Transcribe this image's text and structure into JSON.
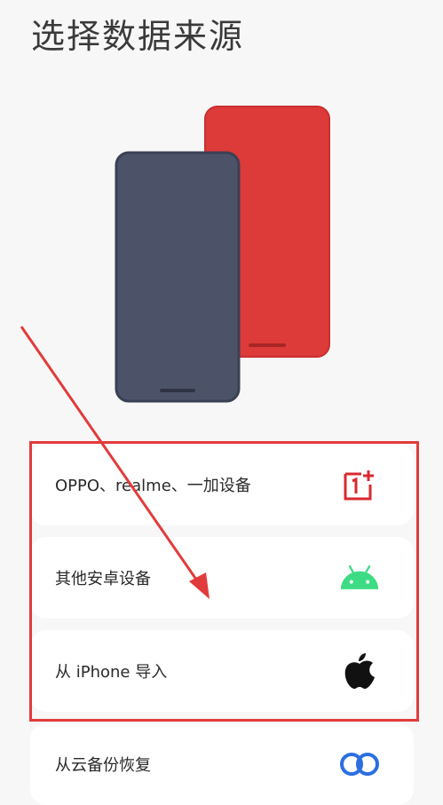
{
  "page": {
    "title": "选择数据来源"
  },
  "options": [
    {
      "label": "OPPO、realme、一加设备",
      "icon": "oneplus-logo-icon"
    },
    {
      "label": "其他安卓设备",
      "icon": "android-icon"
    },
    {
      "label": "从 iPhone 导入",
      "icon": "apple-icon"
    },
    {
      "label": "从云备份恢复",
      "icon": "cloud-backup-icon"
    }
  ],
  "colors": {
    "accent_red": "#e23b3b",
    "phone_dark": "#4c5369",
    "phone_red": "#dd3a3a",
    "android_green": "#3ddc84"
  },
  "annotation": {
    "note": "red highlight box and arrow overlay"
  }
}
